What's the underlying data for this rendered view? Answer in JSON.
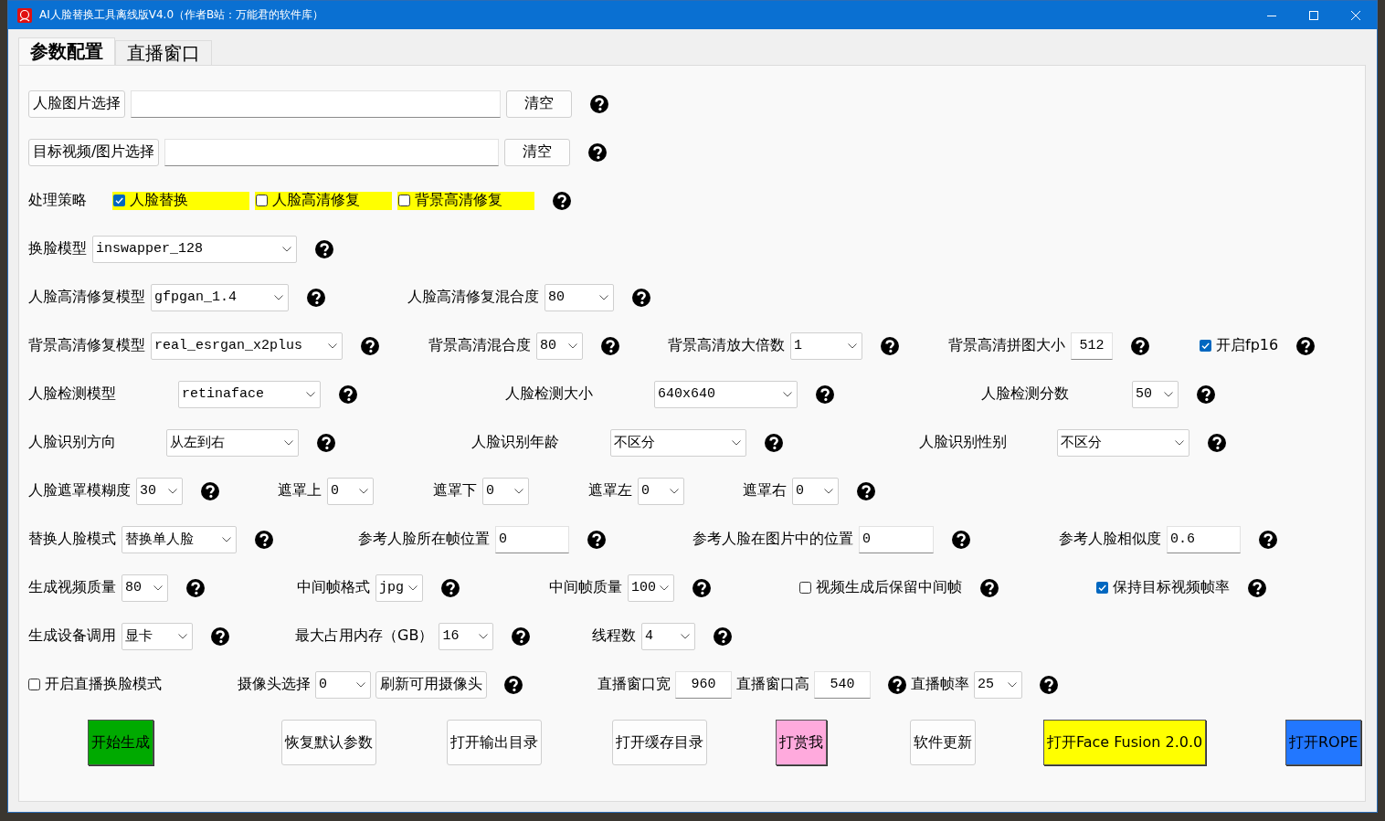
{
  "window": {
    "title": "AI人脸替换工具离线版V4.0（作者B站：万能君的软件库）"
  },
  "tabs": [
    {
      "label": "参数配置",
      "selected": true
    },
    {
      "label": "直播窗口",
      "selected": false
    }
  ],
  "rows": [
    {
      "groups": [
        {
          "items": [
            {
              "kind": "button",
              "label": "人脸图片选择"
            },
            {
              "kind": "input",
              "value": ""
            },
            {
              "kind": "button",
              "label": "清空"
            },
            {
              "kind": "help"
            }
          ]
        }
      ]
    },
    {
      "groups": [
        {
          "items": [
            {
              "kind": "button",
              "label": "目标视频/图片选择"
            },
            {
              "kind": "input",
              "value": ""
            },
            {
              "kind": "button",
              "label": "清空"
            },
            {
              "kind": "help"
            }
          ]
        }
      ]
    },
    {
      "groups": [
        {
          "items": [
            {
              "kind": "label",
              "text": "处理策略"
            },
            {
              "kind": "check",
              "label": "人脸替换",
              "checked": true,
              "color": "#ffff00"
            },
            {
              "kind": "check",
              "label": "人脸高清修复",
              "checked": false,
              "color": "#ffff00"
            },
            {
              "kind": "check",
              "label": "背景高清修复",
              "checked": false,
              "color": "#ffff00"
            },
            {
              "kind": "help"
            }
          ]
        }
      ]
    },
    {
      "groups": [
        {
          "items": [
            {
              "kind": "label",
              "text": "换脸模型"
            },
            {
              "kind": "select",
              "value": "inswapper_128"
            },
            {
              "kind": "help"
            }
          ]
        }
      ]
    },
    {
      "groups": [
        {
          "items": [
            {
              "kind": "label",
              "text": "人脸高清修复模型"
            },
            {
              "kind": "select",
              "value": "gfpgan_1.4"
            },
            {
              "kind": "help"
            }
          ]
        },
        {
          "items": [
            {
              "kind": "label",
              "text": "人脸高清修复混合度"
            },
            {
              "kind": "select",
              "value": "80"
            },
            {
              "kind": "help"
            }
          ]
        }
      ]
    },
    {
      "groups": [
        {
          "items": [
            {
              "kind": "label",
              "text": "背景高清修复模型"
            },
            {
              "kind": "select",
              "value": "real_esrgan_x2plus"
            },
            {
              "kind": "help"
            }
          ]
        },
        {
          "items": [
            {
              "kind": "label",
              "text": "背景高清混合度"
            },
            {
              "kind": "select",
              "value": "80"
            },
            {
              "kind": "help"
            }
          ]
        },
        {
          "items": [
            {
              "kind": "label",
              "text": "背景高清放大倍数"
            },
            {
              "kind": "select",
              "value": "1"
            },
            {
              "kind": "help"
            }
          ]
        },
        {
          "items": [
            {
              "kind": "label",
              "text": "背景高清拼图大小"
            },
            {
              "kind": "input",
              "value": "512"
            },
            {
              "kind": "help"
            }
          ]
        },
        {
          "items": [
            {
              "kind": "check",
              "label": "开启fp16",
              "checked": true
            },
            {
              "kind": "help"
            }
          ]
        }
      ]
    },
    {
      "groups": [
        {
          "items": [
            {
              "kind": "label",
              "text": "人脸检测模型"
            },
            {
              "kind": "select",
              "value": "retinaface"
            },
            {
              "kind": "help"
            }
          ]
        },
        {
          "items": [
            {
              "kind": "label",
              "text": "人脸检测大小"
            },
            {
              "kind": "select",
              "value": "640x640"
            },
            {
              "kind": "help"
            }
          ]
        },
        {
          "items": [
            {
              "kind": "label",
              "text": "人脸检测分数"
            },
            {
              "kind": "select",
              "value": "50"
            },
            {
              "kind": "help"
            }
          ]
        }
      ]
    },
    {
      "groups": [
        {
          "items": [
            {
              "kind": "label",
              "text": "人脸识别方向"
            },
            {
              "kind": "select",
              "value": "从左到右"
            },
            {
              "kind": "help"
            }
          ]
        },
        {
          "items": [
            {
              "kind": "label",
              "text": "人脸识别年龄"
            },
            {
              "kind": "select",
              "value": "不区分"
            },
            {
              "kind": "help"
            }
          ]
        },
        {
          "items": [
            {
              "kind": "label",
              "text": "人脸识别性别"
            },
            {
              "kind": "select",
              "value": "不区分"
            },
            {
              "kind": "help"
            }
          ]
        }
      ]
    },
    {
      "groups": [
        {
          "items": [
            {
              "kind": "label",
              "text": "人脸遮罩模糊度"
            },
            {
              "kind": "select",
              "value": "30"
            },
            {
              "kind": "help"
            }
          ]
        },
        {
          "items": [
            {
              "kind": "label",
              "text": "遮罩上"
            },
            {
              "kind": "select",
              "value": "0"
            }
          ]
        },
        {
          "items": [
            {
              "kind": "label",
              "text": "遮罩下"
            },
            {
              "kind": "select",
              "value": "0"
            }
          ]
        },
        {
          "items": [
            {
              "kind": "label",
              "text": "遮罩左"
            },
            {
              "kind": "select",
              "value": "0"
            }
          ]
        },
        {
          "items": [
            {
              "kind": "label",
              "text": "遮罩右"
            },
            {
              "kind": "select",
              "value": "0"
            },
            {
              "kind": "help"
            }
          ]
        }
      ]
    },
    {
      "groups": [
        {
          "items": [
            {
              "kind": "label",
              "text": "替换人脸模式"
            },
            {
              "kind": "select",
              "value": "替换单人脸"
            },
            {
              "kind": "help"
            }
          ]
        },
        {
          "items": [
            {
              "kind": "label",
              "text": "参考人脸所在帧位置"
            },
            {
              "kind": "input",
              "value": "0"
            },
            {
              "kind": "help"
            }
          ]
        },
        {
          "items": [
            {
              "kind": "label",
              "text": "参考人脸在图片中的位置"
            },
            {
              "kind": "input",
              "value": "0"
            },
            {
              "kind": "help"
            }
          ]
        },
        {
          "items": [
            {
              "kind": "label",
              "text": "参考人脸相似度"
            },
            {
              "kind": "input",
              "value": "0.6"
            },
            {
              "kind": "help"
            }
          ]
        }
      ]
    },
    {
      "groups": [
        {
          "items": [
            {
              "kind": "label",
              "text": "生成视频质量"
            },
            {
              "kind": "select",
              "value": "80"
            },
            {
              "kind": "help"
            }
          ]
        },
        {
          "items": [
            {
              "kind": "label",
              "text": "中间帧格式"
            },
            {
              "kind": "select",
              "value": "jpg"
            },
            {
              "kind": "help"
            }
          ]
        },
        {
          "items": [
            {
              "kind": "label",
              "text": "中间帧质量"
            },
            {
              "kind": "select",
              "value": "100"
            },
            {
              "kind": "help"
            }
          ]
        },
        {
          "items": [
            {
              "kind": "check",
              "label": "视频生成后保留中间帧",
              "checked": false
            },
            {
              "kind": "help"
            }
          ]
        },
        {
          "items": [
            {
              "kind": "check",
              "label": "保持目标视频帧率",
              "checked": true
            },
            {
              "kind": "help"
            }
          ]
        }
      ]
    },
    {
      "groups": [
        {
          "items": [
            {
              "kind": "label",
              "text": "生成设备调用"
            },
            {
              "kind": "select",
              "value": "显卡"
            },
            {
              "kind": "help"
            }
          ]
        },
        {
          "items": [
            {
              "kind": "label",
              "text": "最大占用内存（GB）"
            },
            {
              "kind": "select",
              "value": "16"
            },
            {
              "kind": "help"
            }
          ]
        },
        {
          "items": [
            {
              "kind": "label",
              "text": "线程数"
            },
            {
              "kind": "select",
              "value": "4"
            },
            {
              "kind": "help"
            }
          ]
        }
      ]
    },
    {
      "groups": [
        {
          "items": [
            {
              "kind": "check",
              "label": "开启直播换脸模式",
              "checked": false
            }
          ]
        },
        {
          "items": [
            {
              "kind": "label",
              "text": "摄像头选择"
            },
            {
              "kind": "select",
              "value": "0"
            },
            {
              "kind": "button",
              "label": "刷新可用摄像头"
            },
            {
              "kind": "help"
            }
          ]
        },
        {
          "items": [
            {
              "kind": "label",
              "text": "直播窗口宽"
            },
            {
              "kind": "input",
              "value": "960"
            },
            {
              "kind": "label",
              "text": "直播窗口高"
            },
            {
              "kind": "input",
              "value": "540"
            },
            {
              "kind": "help"
            },
            {
              "kind": "label",
              "text": "直播帧率"
            },
            {
              "kind": "select",
              "value": "25"
            },
            {
              "kind": "help"
            }
          ]
        }
      ]
    }
  ],
  "actions": [
    {
      "label": "开始生成",
      "color": "#00aa00"
    },
    {
      "label": "恢复默认参数"
    },
    {
      "label": "打开输出目录"
    },
    {
      "label": "打开缓存目录"
    },
    {
      "label": "打赏我",
      "color": "#ffaadd"
    },
    {
      "label": "软件更新"
    },
    {
      "label": "打开Face Fusion 2.0.0",
      "color": "#ffff00"
    },
    {
      "label": "打开ROPE",
      "color": "#2277ff"
    }
  ]
}
